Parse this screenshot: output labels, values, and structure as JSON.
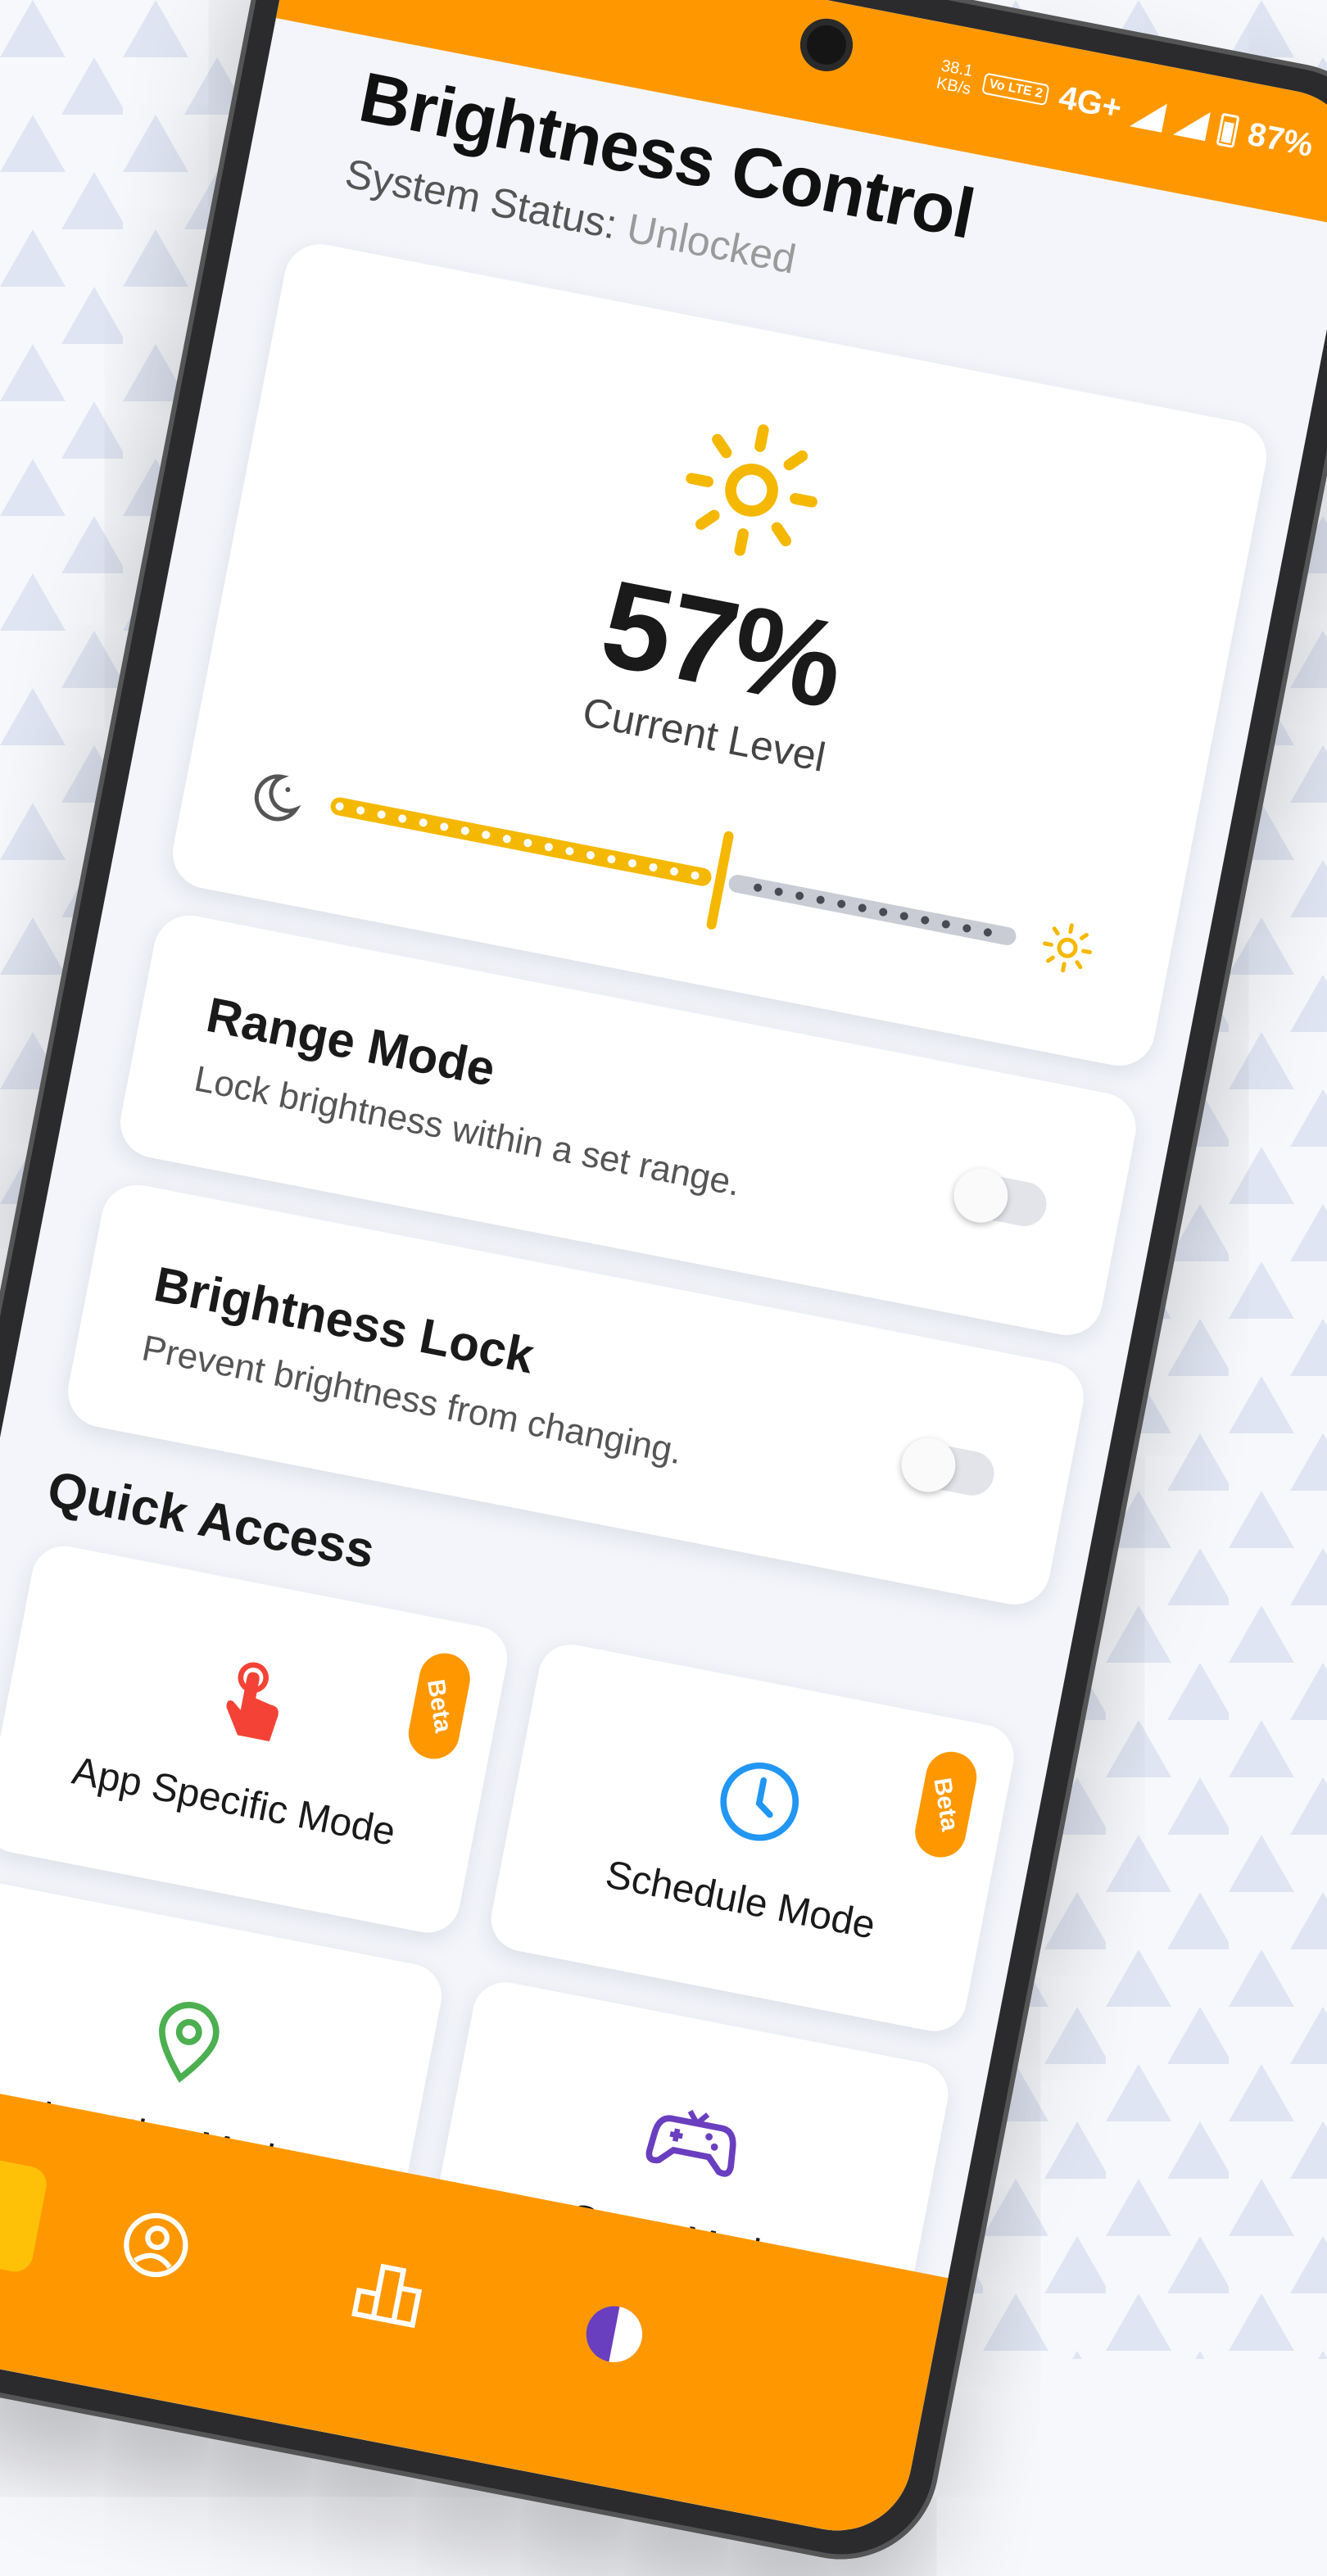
{
  "status_bar": {
    "net_speed": "38.1",
    "net_unit": "KB/s",
    "volte": "Vo LTE 2",
    "network": "4G+",
    "battery": "87%"
  },
  "header": {
    "title": "Brightness Control",
    "status_label": "System Status:",
    "status_value": "Unlocked"
  },
  "level": {
    "value": "57%",
    "label": "Current Level",
    "fraction": 0.57
  },
  "range_mode": {
    "title": "Range Mode",
    "description": "Lock brightness within a set range.",
    "enabled": false
  },
  "brightness_lock": {
    "title": "Brightness Lock",
    "description": "Prevent brightness from changing.",
    "enabled": false
  },
  "quick_access": {
    "title": "Quick Access",
    "tiles": [
      {
        "label": "App Specific Mode",
        "icon": "touch-hand-icon",
        "badge": "Beta"
      },
      {
        "label": "Schedule Mode",
        "icon": "clock-icon",
        "badge": "Beta"
      },
      {
        "label": "Location Mode",
        "icon": "location-pin-icon",
        "badge": ""
      },
      {
        "label": "Game Mode",
        "icon": "gamepad-icon",
        "badge": ""
      }
    ]
  },
  "nav": {
    "items": [
      "home-icon",
      "profile-icon",
      "stats-icon",
      "theme-icon"
    ]
  },
  "colors": {
    "accent": "#ff9800",
    "sun": "#f5b800",
    "track_inactive": "#c9ccd4"
  }
}
